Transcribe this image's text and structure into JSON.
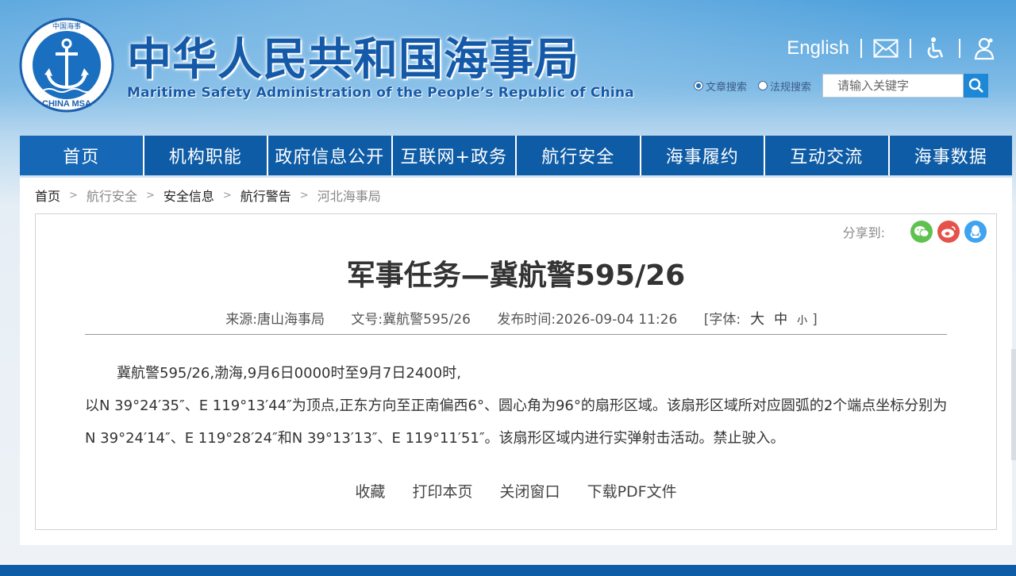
{
  "header": {
    "title_cn": "中华人民共和国海事局",
    "title_en": "Maritime Safety Administration of the People’s Republic of China",
    "logo_text": "CHINA MSA",
    "logo_top_text": "中国海事",
    "top_links": {
      "english": "English"
    },
    "icons": [
      "mail-icon",
      "accessibility-icon",
      "user-icon"
    ]
  },
  "search": {
    "option_article": "文章搜索",
    "option_law": "法规搜索",
    "placeholder": "请输入关键字"
  },
  "nav": {
    "items": [
      "首页",
      "机构职能",
      "政府信息公开",
      "互联网+政务",
      "航行安全",
      "海事履约",
      "互动交流",
      "海事数据"
    ]
  },
  "breadcrumb": {
    "items": [
      "首页",
      "航行安全",
      "安全信息",
      "航行警告",
      "河北海事局"
    ],
    "separator": ">"
  },
  "share": {
    "label": "分享到:"
  },
  "article": {
    "title": "军事任务—冀航警595/26",
    "source": "来源:唐山海事局",
    "doc_no": "文号:冀航警595/26",
    "published": "发布时间:2026-09-04 11:26",
    "font_label": "[字体:",
    "font_large": "大",
    "font_medium": "中",
    "font_small": "小",
    "font_end": "]",
    "paragraph_1": "冀航警595/26,渤海,9月6日0000时至9月7日2400时,",
    "paragraph_2": "以N 39°24′35″、E 119°13′44″为顶点,正东方向至正南偏西6°、圆心角为96°的扇形区域。该扇形区域所对应圆弧的2个端点坐标分别为N 39°24′14″、E 119°28′24″和N 39°13′13″、E 119°11′51″。该扇形区域内进行实弹射击活动。禁止驶入。"
  },
  "actions": {
    "favorite": "收藏",
    "print": "打印本页",
    "close": "关闭窗口",
    "download": "下载PDF文件"
  },
  "colors": {
    "nav": "#0f5ca6",
    "title_blue": "#155aa8",
    "wechat": "#5fc24f",
    "weibo": "#e5524a",
    "qq": "#3fa3ef"
  }
}
